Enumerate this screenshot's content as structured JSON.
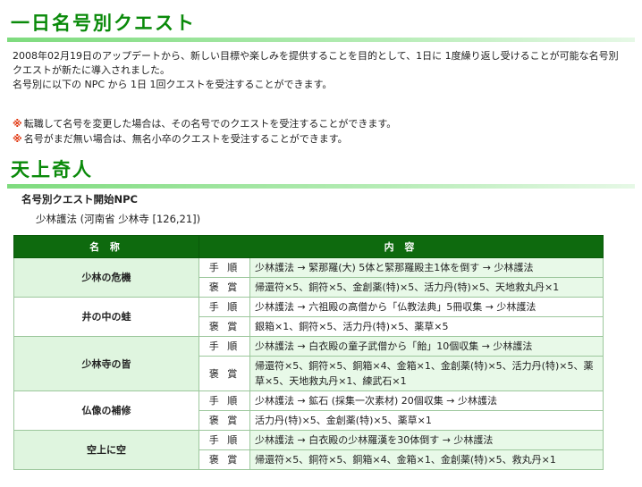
{
  "heading1": "一日名号別クエスト",
  "intro": {
    "line1": "2008年02月19日のアップデートから、新しい目標や楽しみを提供することを目的として、1日に 1度繰り返し受けることが可能な名号別",
    "line2": "クエストが新たに導入されました。",
    "line3": "名号別に以下の NPC から 1日 1回クエストを受注することができます。"
  },
  "notes": [
    {
      "mark": "※",
      "text": "転職して名号を変更した場合は、その名号でのクエストを受注することができます。"
    },
    {
      "mark": "※",
      "text": "名号がまだ無い場合は、無名小卒のクエストを受注することができます。"
    }
  ],
  "heading2": "天上奇人",
  "npc": {
    "title": "名号別クエスト開始NPC",
    "name": "少林護法 (河南省 少林寺 [126,21])"
  },
  "table": {
    "col_name": "名 称",
    "col_content": "内 容",
    "label_steps": "手 順",
    "label_reward": "褒 賞",
    "rows": [
      {
        "name": "少林の危機",
        "steps": "少林護法 → 緊那羅(大) 5体と緊那羅殿主1体を倒す → 少林護法",
        "reward": "帰還符×5、銅符×5、金創薬(特)×5、活力丹(特)×5、天地救丸丹×1"
      },
      {
        "name": "井の中の蛙",
        "steps": "少林護法 → 六祖殿の高僧から「仏教法典」5冊収集 → 少林護法",
        "reward": "銀箱×1、銅符×5、活力丹(特)×5、薬草×5"
      },
      {
        "name": "少林寺の皆",
        "steps": "少林護法 → 白衣殿の童子武僧から「飴」10個収集 → 少林護法",
        "reward": "帰還符×5、銅符×5、銅箱×4、金箱×1、金創薬(特)×5、活力丹(特)×5、薬草×5、天地救丸丹×1、練武石×1"
      },
      {
        "name": "仏像の補修",
        "steps": "少林護法 → 鉱石 (採集一次素材) 20個収集 → 少林護法",
        "reward": "活力丹(特)×5、金創薬(特)×5、薬草×1"
      },
      {
        "name": "空上に空",
        "steps": "少林護法 → 白衣殿の少林羅漢を30体倒す → 少林護法",
        "reward": "帰還符×5、銅符×5、銅箱×4、金箱×1、金創薬(特)×5、救丸丹×1"
      }
    ]
  }
}
